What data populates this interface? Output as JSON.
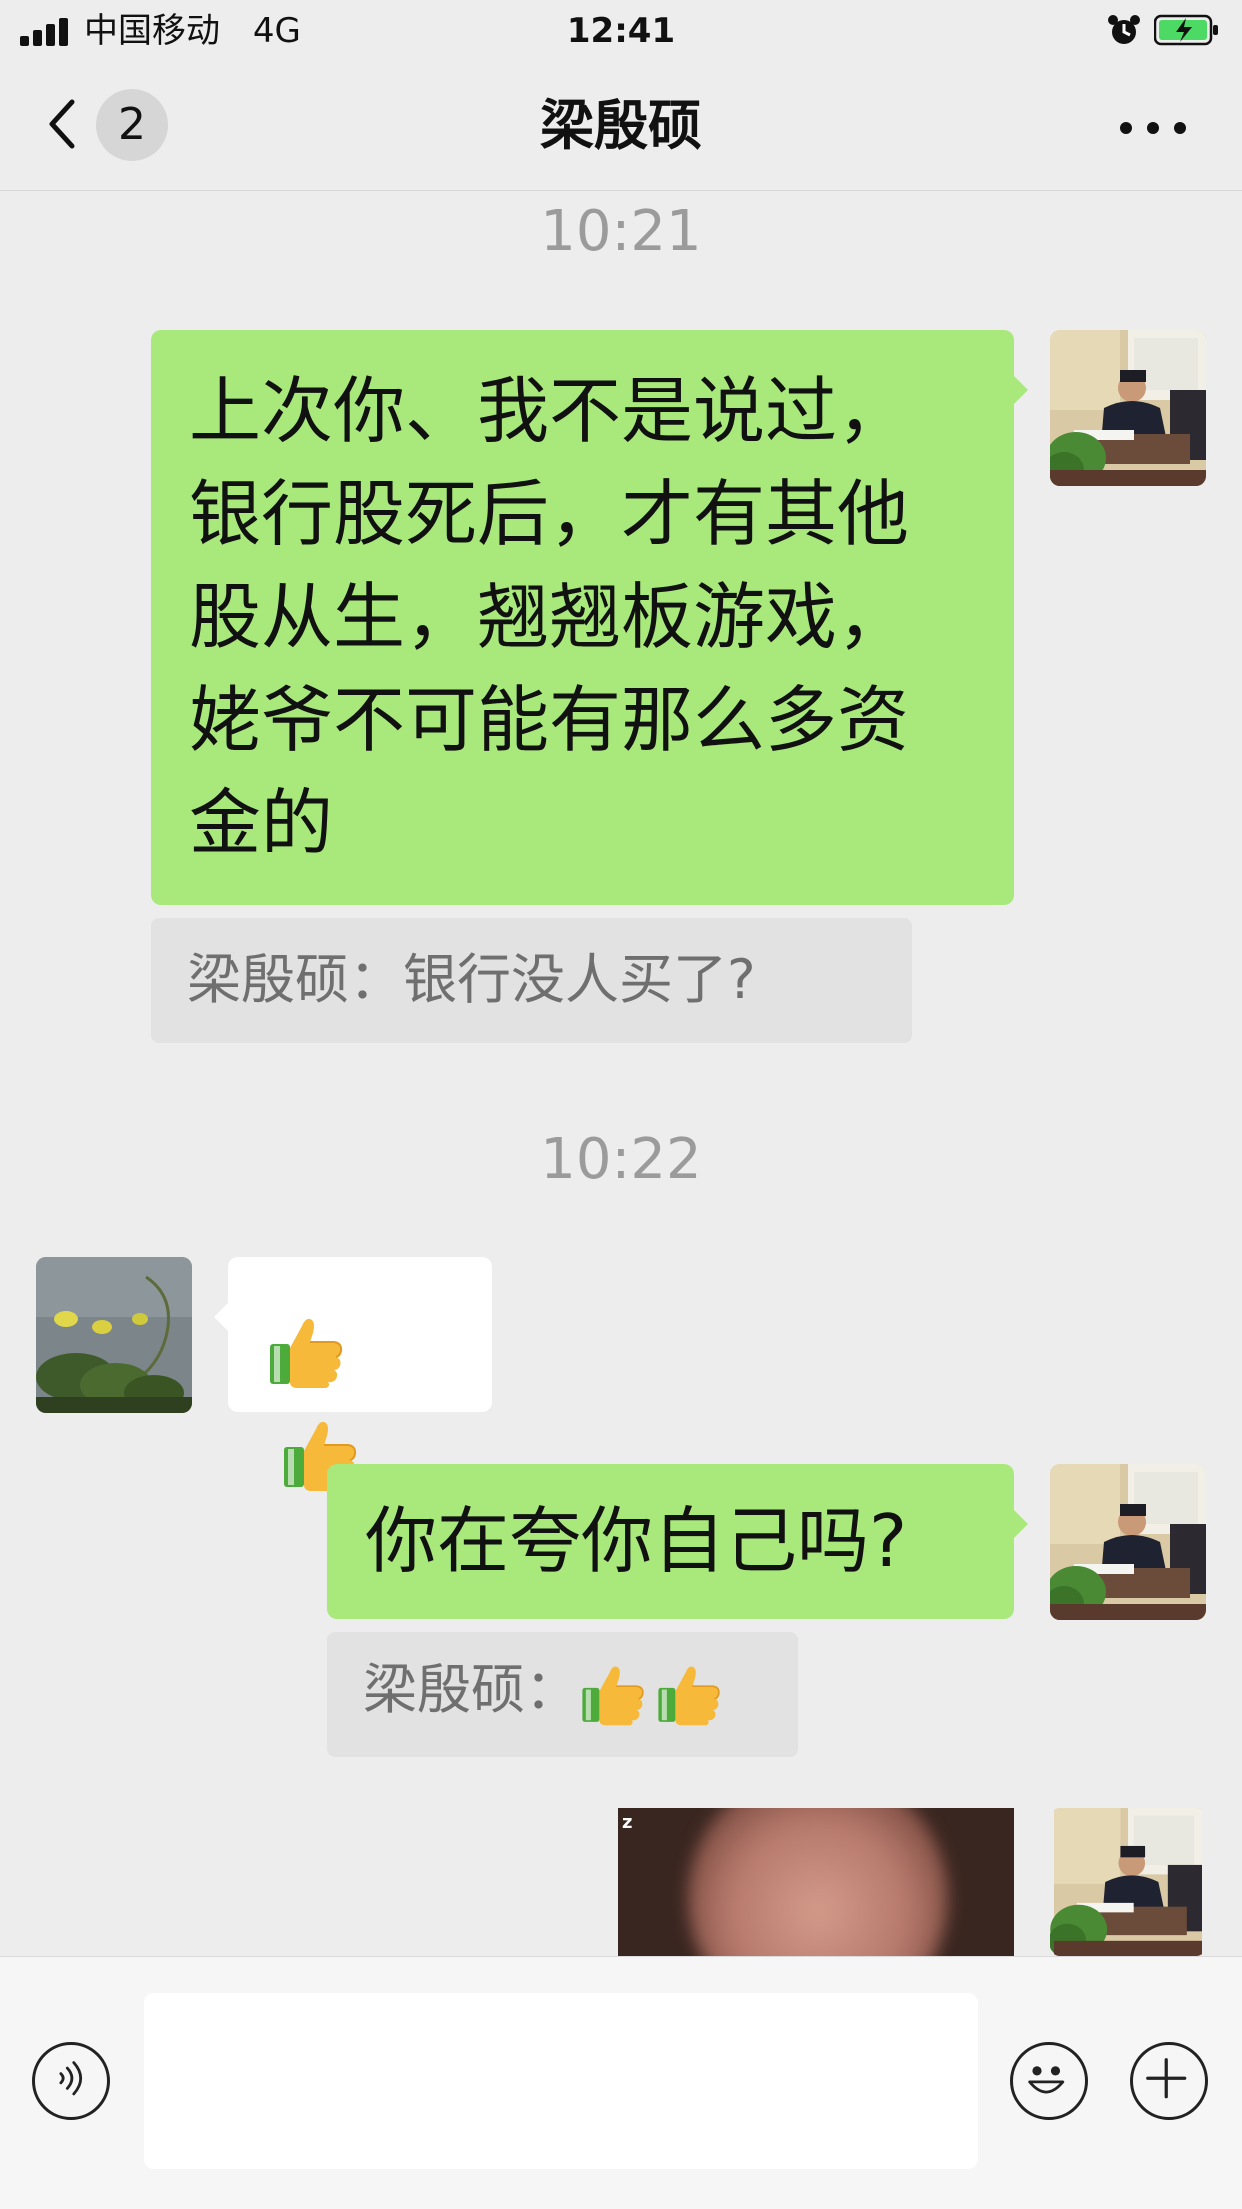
{
  "status_bar": {
    "carrier": "中国移动",
    "network": "4G",
    "time": "12:41",
    "icons": [
      "signal-icon",
      "alarm-icon",
      "battery-charging-icon"
    ]
  },
  "nav": {
    "unread_count": "2",
    "title": "梁殷硕",
    "icons": [
      "back-chevron-icon",
      "more-dots-icon"
    ]
  },
  "messages": {
    "time_1": "10:21",
    "msg_1": {
      "line_1": "上次你、我不是说过，",
      "line_2": "银行股死后，才有其他",
      "line_3": "股从生，翘翘板游戏，",
      "line_4": "姥爷不可能有那么多资",
      "line_5": "金的"
    },
    "quote_1": "梁殷硕：银行没人买了?",
    "time_2": "10:22",
    "msg_2_emoji": "thumbs-up-icon x2",
    "msg_3": "你在夸你自己吗?",
    "quote_3_prefix": "梁殷硕：",
    "quote_3_emoji": "thumbs-up-icon x2",
    "msg_4_image_corner": "z"
  },
  "input_bar": {
    "icons": [
      "voice-icon",
      "emoji-icon",
      "plus-icon"
    ],
    "text": ""
  },
  "colors": {
    "background": "#ededed",
    "sent_bubble": "#a9e97c",
    "received_bubble": "#ffffff",
    "quote_bg": "#e2e2e2",
    "timestamp": "#9b9b9b"
  }
}
